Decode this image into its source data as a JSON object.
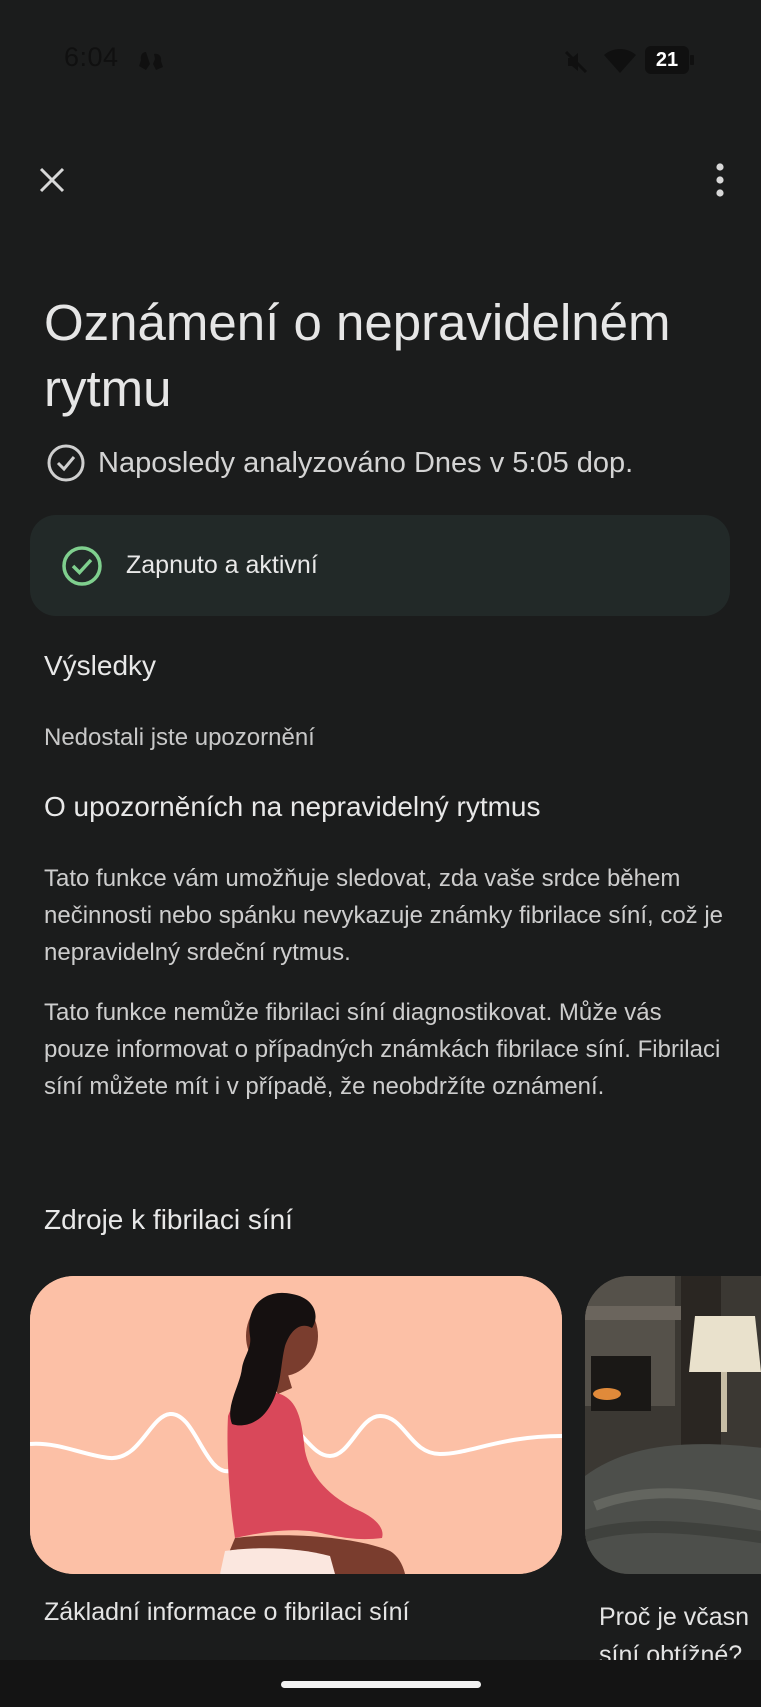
{
  "status_bar": {
    "time": "6:04",
    "battery_level": "21",
    "icons": [
      "app-notification-icon",
      "mute-icon",
      "wifi-icon",
      "battery-icon"
    ]
  },
  "top_bar": {
    "close_icon": "close-icon",
    "more_icon": "more-vert-icon"
  },
  "header": {
    "title": "Oznámení o nepravidelném rytmu",
    "last_analyzed": "Naposledy analyzováno Dnes v 5:05 dop.",
    "last_analyzed_icon": "check-circle-icon"
  },
  "status_card": {
    "label": "Zapnuto a aktivní",
    "icon": "check-circle-icon",
    "icon_color": "#7fcf8e"
  },
  "results": {
    "heading": "Výsledky",
    "text": "Nedostali jste upozornění"
  },
  "about": {
    "heading": "O upozorněních na nepravidelný rytmus",
    "paragraph_1": "Tato funkce vám umožňuje sledovat, zda vaše srdce během nečinnosti nebo spánku nevykazuje známky fibrilace síní, což je nepravidelný srdeční rytmus.",
    "paragraph_2": "Tato funkce nemůže fibrilaci síní diagnostikovat. Může vás pouze informovat o případných známkách fibrilace síní. Fibrilaci síní můžete mít i v případě, že neobdržíte oznámení."
  },
  "resources": {
    "heading": "Zdroje k fibrilaci síní",
    "cards": [
      {
        "label": "Základní informace o fibrilaci síní",
        "image": "woman-heart-rhythm-illustration"
      },
      {
        "label": "Proč je včasn\nsíní obtížné?",
        "image": "bedroom-photo"
      }
    ]
  },
  "colors": {
    "background": "#1b1c1c",
    "card_background": "#222928",
    "accent_green": "#7fcf8e",
    "illustration_background": "#fcc0a6"
  }
}
